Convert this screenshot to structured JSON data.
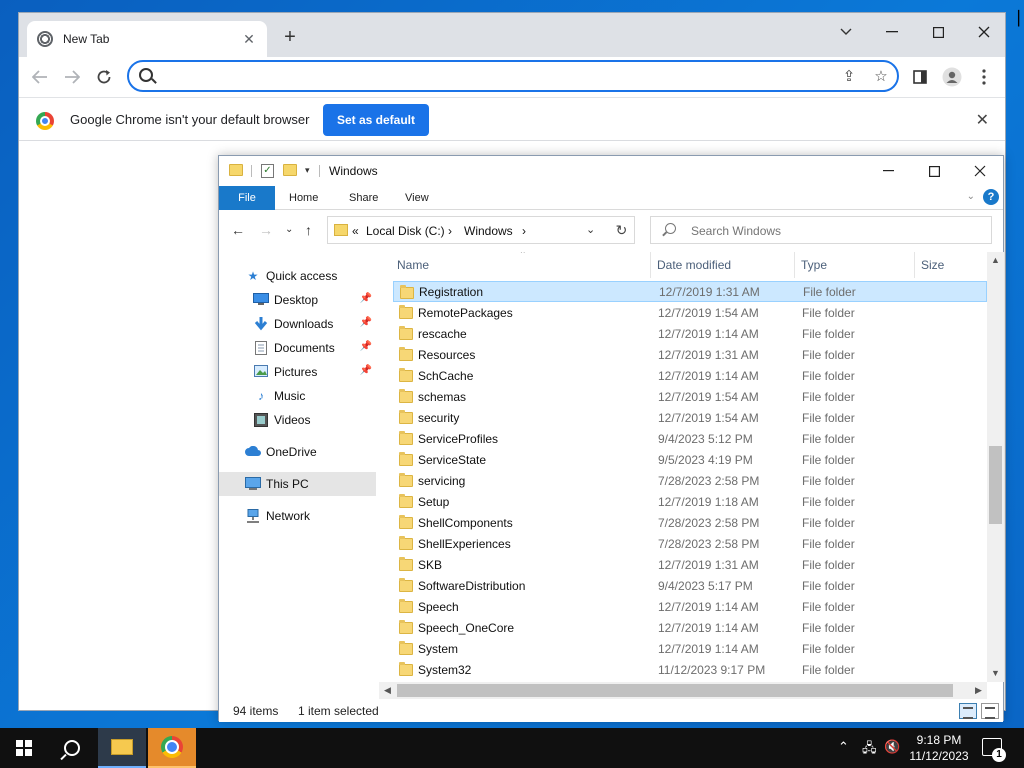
{
  "chrome": {
    "tab_title": "New Tab",
    "tab_close": "✕",
    "new_tab": "+",
    "minimize_chevron": "⌄",
    "omnibox_value": "",
    "omnibox_placeholder": "",
    "infobar_text": "Google Chrome isn't your default browser",
    "set_default_label": "Set as default",
    "infobar_close": "✕"
  },
  "explorer": {
    "title": "Windows",
    "ribbon_tabs": [
      "File",
      "Home",
      "Share",
      "View"
    ],
    "address": {
      "prefix": "«",
      "segments": [
        "Local Disk (C:)",
        "Windows"
      ],
      "sep": "›"
    },
    "search_placeholder": "Search Windows",
    "nav": [
      {
        "label": "Quick access",
        "icon": "star-icon",
        "pinned": false
      },
      {
        "label": "Desktop",
        "icon": "desktop-icon",
        "pinned": true
      },
      {
        "label": "Downloads",
        "icon": "download-icon",
        "pinned": true
      },
      {
        "label": "Documents",
        "icon": "documents-icon",
        "pinned": true
      },
      {
        "label": "Pictures",
        "icon": "pictures-icon",
        "pinned": true
      },
      {
        "label": "Music",
        "icon": "music-icon",
        "pinned": false
      },
      {
        "label": "Videos",
        "icon": "videos-icon",
        "pinned": false
      },
      {
        "label": "OneDrive",
        "icon": "cloud-icon",
        "pinned": false
      },
      {
        "label": "This PC",
        "icon": "computer-icon",
        "pinned": false
      },
      {
        "label": "Network",
        "icon": "network-icon",
        "pinned": false
      }
    ],
    "columns": [
      "Name",
      "Date modified",
      "Type",
      "Size"
    ],
    "files": [
      {
        "name": "Registration",
        "date": "12/7/2019 1:31 AM",
        "type": "File folder"
      },
      {
        "name": "RemotePackages",
        "date": "12/7/2019 1:54 AM",
        "type": "File folder"
      },
      {
        "name": "rescache",
        "date": "12/7/2019 1:14 AM",
        "type": "File folder"
      },
      {
        "name": "Resources",
        "date": "12/7/2019 1:31 AM",
        "type": "File folder"
      },
      {
        "name": "SchCache",
        "date": "12/7/2019 1:14 AM",
        "type": "File folder"
      },
      {
        "name": "schemas",
        "date": "12/7/2019 1:54 AM",
        "type": "File folder"
      },
      {
        "name": "security",
        "date": "12/7/2019 1:54 AM",
        "type": "File folder"
      },
      {
        "name": "ServiceProfiles",
        "date": "9/4/2023 5:12 PM",
        "type": "File folder"
      },
      {
        "name": "ServiceState",
        "date": "9/5/2023 4:19 PM",
        "type": "File folder"
      },
      {
        "name": "servicing",
        "date": "7/28/2023 2:58 PM",
        "type": "File folder"
      },
      {
        "name": "Setup",
        "date": "12/7/2019 1:18 AM",
        "type": "File folder"
      },
      {
        "name": "ShellComponents",
        "date": "7/28/2023 2:58 PM",
        "type": "File folder"
      },
      {
        "name": "ShellExperiences",
        "date": "7/28/2023 2:58 PM",
        "type": "File folder"
      },
      {
        "name": "SKB",
        "date": "12/7/2019 1:31 AM",
        "type": "File folder"
      },
      {
        "name": "SoftwareDistribution",
        "date": "9/4/2023 5:17 PM",
        "type": "File folder"
      },
      {
        "name": "Speech",
        "date": "12/7/2019 1:14 AM",
        "type": "File folder"
      },
      {
        "name": "Speech_OneCore",
        "date": "12/7/2019 1:14 AM",
        "type": "File folder"
      },
      {
        "name": "System",
        "date": "12/7/2019 1:14 AM",
        "type": "File folder"
      },
      {
        "name": "System32",
        "date": "11/12/2023 9:17 PM",
        "type": "File folder"
      }
    ],
    "status_items": "94 items",
    "status_selected": "1 item selected",
    "help": "?"
  },
  "taskbar": {
    "time": "9:18 PM",
    "date": "11/12/2023",
    "notification_count": "1"
  }
}
